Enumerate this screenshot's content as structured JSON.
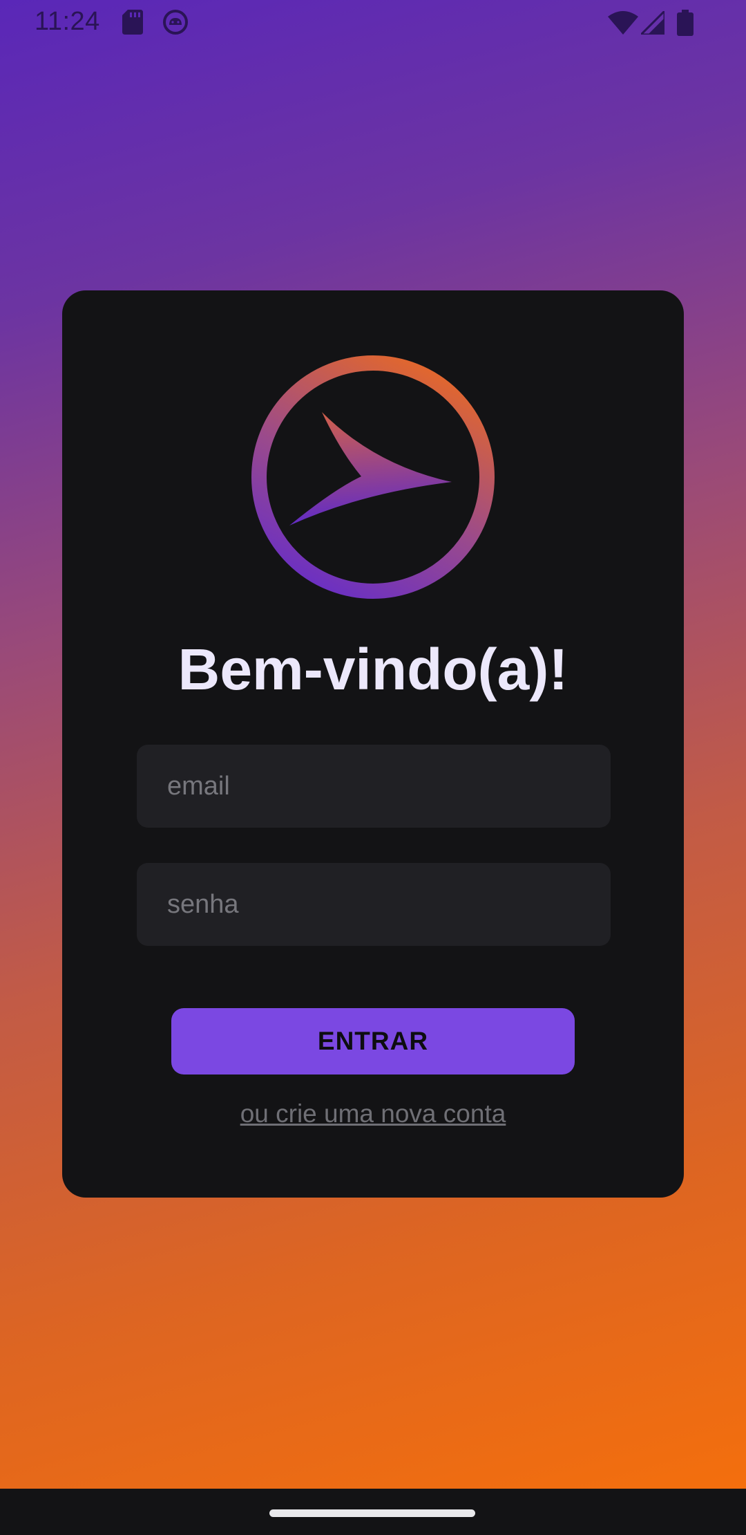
{
  "status_bar": {
    "time": "11:24",
    "left_icons": [
      "sd-card-icon",
      "android-debug-icon"
    ],
    "right_icons": [
      "wifi-icon",
      "cell-signal-icon",
      "battery-icon"
    ]
  },
  "login": {
    "welcome_title": "Bem-vindo(a)!",
    "email_placeholder": "email",
    "password_placeholder": "senha",
    "enter_button": "ENTRAR",
    "create_account_link": "ou crie uma nova conta"
  },
  "colors": {
    "background_top": "#5a27b8",
    "background_bottom": "#f7700a",
    "card": "#131315",
    "field": "#202024",
    "button": "#7b48e2",
    "title": "#ece8fb"
  }
}
